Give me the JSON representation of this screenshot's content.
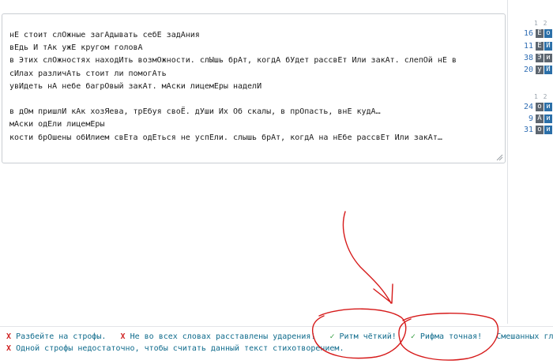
{
  "editor": {
    "lines": [
      "нЕ стоит слОжные загАдывать себЕ задАния",
      "вЕдь И тАк ужЕ кругом головА",
      "в Этих слОжностях находИть возмОжности. слЫшь брАт, когдА бУдет рассвЕт Или закАт. слепОй нЕ в",
      "сИлах различАть стоит ли помогАть",
      "увИдеть нА небе багрОвый закАт. мАски лицемЕры наделИ",
      "",
      "в дОм пришлИ кАк хозЯева, трЕбуя своЁ. дУши Их Об скалы, в прОпасть, внЕ кудА…",
      "мАски одЕли лицемЕры",
      "кости брОшены обИлием свЕта одЕться не успЕли. слышь брАт, когдА на нЕбе рассвЕт Или закАт…"
    ]
  },
  "analysis": {
    "blocks": [
      {
        "head": "1 2",
        "rows": [
          {
            "num": "16",
            "c1": "Е",
            "c2": "о"
          },
          {
            "num": "11",
            "c1": "Е",
            "c2": "И"
          },
          {
            "num": "38",
            "c1": "Э",
            "c2": "и"
          },
          {
            "num": "20",
            "c1": "у",
            "c2": "И"
          }
        ]
      },
      {
        "head": "1 2",
        "rows": [
          {
            "num": "24",
            "c1": "о",
            "c2": "и"
          },
          {
            "num": "9",
            "c1": "А",
            "c2": "и"
          },
          {
            "num": "31",
            "c1": "о",
            "c2": "и"
          }
        ]
      }
    ]
  },
  "status": {
    "line1": [
      {
        "mark": "X",
        "type": "error",
        "text": "Разбейте на строфы."
      },
      {
        "mark": "X",
        "type": "error",
        "text": "Не во всех словах расставлены ударения!"
      },
      {
        "mark": "✓",
        "type": "ok",
        "text": "Ритм чёткий!"
      },
      {
        "mark": "✓",
        "type": "ok",
        "text": "Рифма точная!"
      },
      {
        "mark": "",
        "type": "info",
        "text": "Смешанных гл"
      }
    ],
    "line2": [
      {
        "mark": "X",
        "type": "error",
        "text": "Одной строфы недостаточно, чтобы считать данный текст стихотворением."
      }
    ]
  },
  "colors": {
    "error_mark": "#d02424",
    "ok_mark": "#2d9a3a",
    "status_text": "#0f6b8c",
    "annotation": "#d61a1a",
    "cell_gray": "#5d6670",
    "cell_blue": "#2b6fa8"
  }
}
